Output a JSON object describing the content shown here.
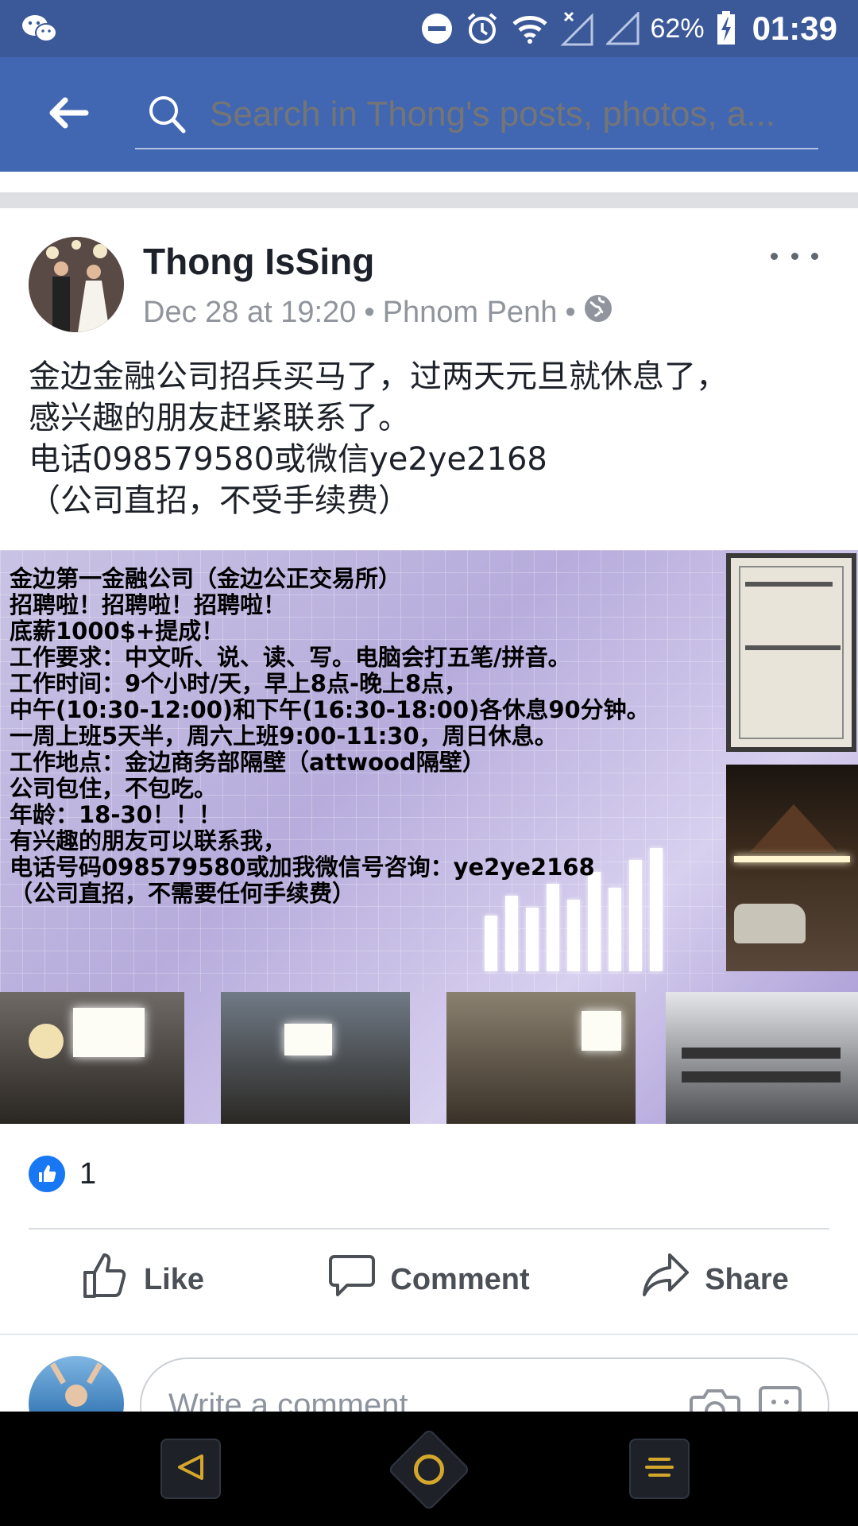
{
  "status_bar": {
    "battery": "62%",
    "time": "01:39"
  },
  "search": {
    "placeholder": "Search in Thong's posts, photos, a..."
  },
  "post": {
    "author": "Thong IsSing",
    "date": "Dec 28 at 19:20",
    "location": "Phnom Penh",
    "separator": "•",
    "text_lines": [
      "金边金融公司招兵买马了，过两天元旦就休息了，",
      "感兴趣的朋友赶紧联系了。",
      "电话098579580或微信ye2ye2168",
      "（公司直招，不受手续费）"
    ],
    "image_text_lines": [
      "金边第一金融公司（金边公正交易所）",
      "招聘啦！招聘啦！招聘啦！",
      "底薪1000$+提成！",
      "工作要求：中文听、说、读、写。电脑会打五笔/拼音。",
      "工作时间：9个小时/天，早上8点-晚上8点，",
      "中午(10:30-12:00)和下午(16:30-18:00)各休息90分钟。",
      "一周上班5天半，周六上班9:00-11:30，周日休息。",
      "工作地点：金边商务部隔壁（attwood隔壁）",
      "公司包住，不包吃。",
      "年龄：18-30！！！",
      "有兴趣的朋友可以联系我，",
      "电话号码098579580或加我微信号咨询：ye2ye2168",
      "（公司直招，不需要任何手续费）"
    ],
    "reaction_count": "1"
  },
  "actions": {
    "like": "Like",
    "comment": "Comment",
    "share": "Share"
  },
  "composer": {
    "placeholder": "Write a comment..."
  },
  "colors": {
    "status_bar": "#3b5998",
    "app_bar": "#4267b2",
    "like_blue": "#1877f2",
    "nav_accent": "#d4a72c"
  }
}
